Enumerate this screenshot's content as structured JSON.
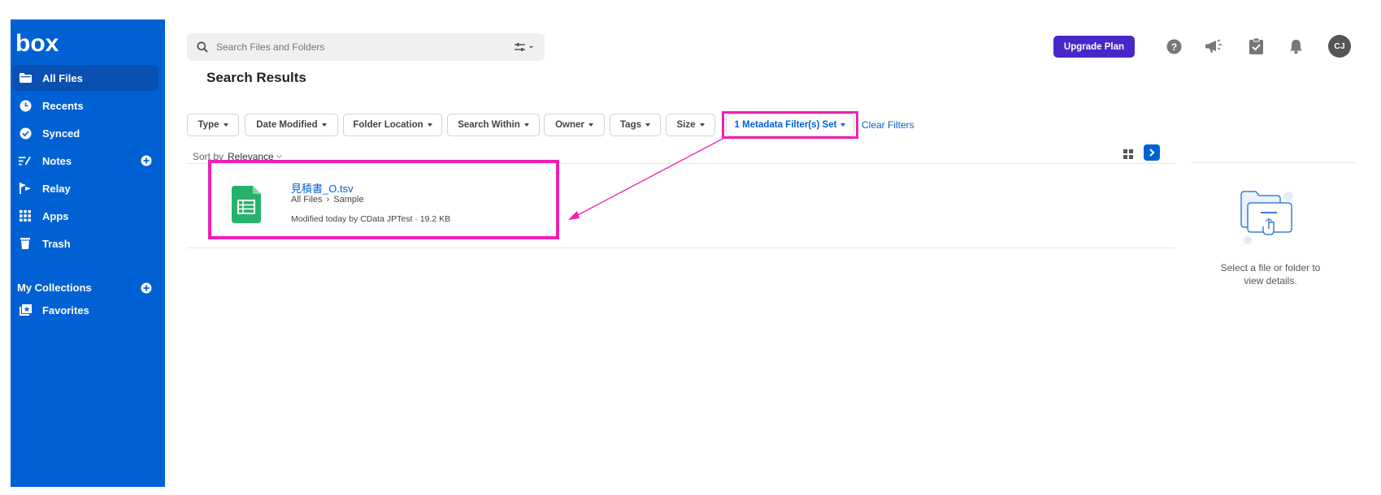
{
  "sidebar": {
    "logo_text": "box",
    "items": [
      {
        "label": "All Files",
        "icon": "folder-icon"
      },
      {
        "label": "Recents",
        "icon": "clock-icon"
      },
      {
        "label": "Synced",
        "icon": "check-circle-icon"
      },
      {
        "label": "Notes",
        "icon": "notes-icon"
      },
      {
        "label": "Relay",
        "icon": "relay-icon"
      },
      {
        "label": "Apps",
        "icon": "apps-grid-icon"
      },
      {
        "label": "Trash",
        "icon": "trash-icon"
      }
    ],
    "collections_label": "My Collections",
    "favorites_label": "Favorites"
  },
  "header": {
    "search_placeholder": "Search Files and Folders",
    "upgrade_label": "Upgrade Plan",
    "avatar_initials": "CJ"
  },
  "main": {
    "title": "Search Results",
    "filters": [
      "Type",
      "Date Modified",
      "Folder Location",
      "Search Within",
      "Owner",
      "Tags",
      "Size",
      "1 Metadata Filter(s) Set"
    ],
    "clear_filters": "Clear Filters",
    "sort_label": "Sort by",
    "sort_value": "Relevance",
    "results": [
      {
        "name": "見積書_O.tsv",
        "path_root": "All Files",
        "path_folder": "Sample",
        "meta": "Modified today by CData JPTest · 19.2 KB"
      }
    ]
  },
  "details": {
    "empty_text": "Select a file or folder to view details."
  },
  "colors": {
    "brand_blue": "#0061d5",
    "upgrade_purple": "#4827c9",
    "highlight_pink": "#f01fb4",
    "spreadsheet_green": "#26b26b"
  }
}
